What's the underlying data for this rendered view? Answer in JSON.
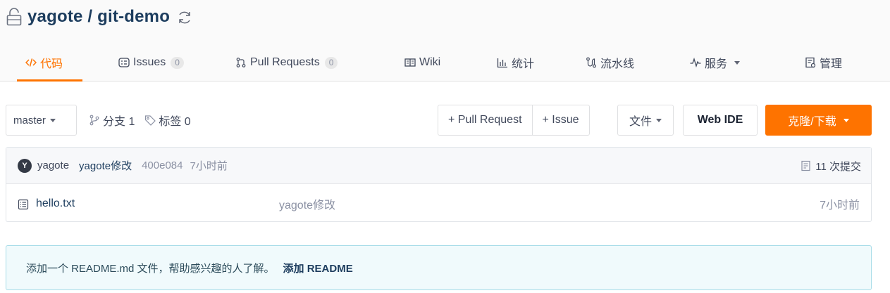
{
  "repo": {
    "title": "yagote / git-demo"
  },
  "tabs": [
    {
      "label": "代码"
    },
    {
      "label": "Issues",
      "count": "0"
    },
    {
      "label": "Pull Requests",
      "count": "0"
    },
    {
      "label": "Wiki"
    },
    {
      "label": "统计"
    },
    {
      "label": "流水线"
    },
    {
      "label": "服务"
    },
    {
      "label": "管理"
    }
  ],
  "toolbar": {
    "branch": "master",
    "branches": "分支 1",
    "tags": "标签 0",
    "pull_request": "+ Pull Request",
    "issue": "+ Issue",
    "files": "文件",
    "web_ide": "Web IDE",
    "clone": "克隆/下载"
  },
  "commit": {
    "avatar": "Y",
    "author": "yagote",
    "message": "yagote修改",
    "sha": "400e084",
    "time": "7小时前",
    "total": "11 次提交"
  },
  "files": [
    {
      "name": "hello.txt",
      "message": "yagote修改",
      "time": "7小时前"
    }
  ],
  "readme_tip": {
    "text": "添加一个 README.md 文件，帮助感兴趣的人了解。",
    "link": "添加 README"
  },
  "colors": {
    "accent": "#fe7300",
    "link": "#1d3d5e",
    "muted": "#8c92a4"
  }
}
